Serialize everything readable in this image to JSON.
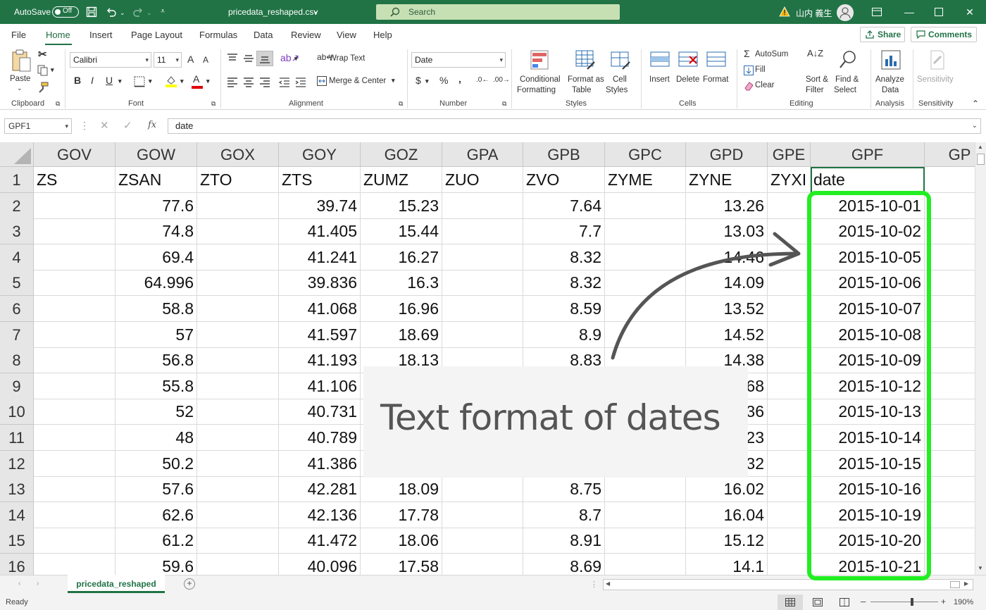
{
  "titlebar": {
    "autosave_label": "AutoSave",
    "autosave_state": "Off",
    "filename": "pricedata_reshaped.csv",
    "search_placeholder": "Search",
    "user_name": "山内 義生",
    "colors": {
      "bar": "#217346",
      "search_bg": "#c6e0b4"
    }
  },
  "menu": {
    "tabs": [
      "File",
      "Home",
      "Insert",
      "Page Layout",
      "Formulas",
      "Data",
      "Review",
      "View",
      "Help"
    ],
    "active_tab": "Home",
    "share_label": "Share",
    "comments_label": "Comments"
  },
  "ribbon": {
    "clipboard": {
      "paste": "Paste",
      "label": "Clipboard"
    },
    "font": {
      "name": "Calibri",
      "size": "11",
      "label": "Font"
    },
    "alignment": {
      "wrap_text": "Wrap Text",
      "merge_center": "Merge & Center",
      "label": "Alignment"
    },
    "number": {
      "format": "Date",
      "label": "Number"
    },
    "styles": {
      "conditional_1": "Conditional",
      "conditional_2": "Formatting",
      "format_as_1": "Format as",
      "format_as_2": "Table",
      "cell_styles_1": "Cell",
      "cell_styles_2": "Styles",
      "label": "Styles"
    },
    "cells": {
      "insert": "Insert",
      "delete": "Delete",
      "format": "Format",
      "label": "Cells"
    },
    "editing": {
      "autosum": "AutoSum",
      "fill": "Fill",
      "clear": "Clear",
      "sort_1": "Sort &",
      "sort_2": "Filter",
      "find_1": "Find &",
      "find_2": "Select",
      "label": "Editing"
    },
    "analysis": {
      "analyze_1": "Analyze",
      "analyze_2": "Data",
      "label": "Analysis"
    },
    "sensitivity": {
      "button": "Sensitivity",
      "label": "Sensitivity"
    }
  },
  "formula_bar": {
    "name_box": "GPF1",
    "fx": "fx",
    "content": "date"
  },
  "sheet": {
    "columns": [
      "GOV",
      "GOW",
      "GOX",
      "GOY",
      "GOZ",
      "GPA",
      "GPB",
      "GPC",
      "GPD",
      "GPE",
      "GPF",
      "GP"
    ],
    "row_numbers": [
      "1",
      "2",
      "3",
      "4",
      "5",
      "6",
      "7",
      "8",
      "9",
      "10",
      "11",
      "12",
      "13",
      "14",
      "15",
      "16"
    ],
    "rows": [
      [
        "ZS",
        "ZSAN",
        "ZTO",
        "ZTS",
        "ZUMZ",
        "ZUO",
        "ZVO",
        "ZYME",
        "ZYNE",
        "ZYXI",
        "date"
      ],
      [
        "",
        "77.6",
        "",
        "39.74",
        "15.23",
        "",
        "7.64",
        "",
        "13.26",
        "",
        "2015-10-01"
      ],
      [
        "",
        "74.8",
        "",
        "41.405",
        "15.44",
        "",
        "7.7",
        "",
        "13.03",
        "",
        "2015-10-02"
      ],
      [
        "",
        "69.4",
        "",
        "41.241",
        "16.27",
        "",
        "8.32",
        "",
        "14.46",
        "",
        "2015-10-05"
      ],
      [
        "",
        "64.996",
        "",
        "39.836",
        "16.3",
        "",
        "8.32",
        "",
        "14.09",
        "",
        "2015-10-06"
      ],
      [
        "",
        "58.8",
        "",
        "41.068",
        "16.96",
        "",
        "8.59",
        "",
        "13.52",
        "",
        "2015-10-07"
      ],
      [
        "",
        "57",
        "",
        "41.597",
        "18.69",
        "",
        "8.9",
        "",
        "14.52",
        "",
        "2015-10-08"
      ],
      [
        "",
        "56.8",
        "",
        "41.193",
        "18.13",
        "",
        "8.83",
        "",
        "14.38",
        "",
        "2015-10-09"
      ],
      [
        "",
        "55.8",
        "",
        "41.106",
        "",
        "",
        "",
        "",
        "68",
        "",
        "2015-10-12"
      ],
      [
        "",
        "52",
        "",
        "40.731",
        "",
        "",
        "",
        "",
        "36",
        "",
        "2015-10-13"
      ],
      [
        "",
        "48",
        "",
        "40.789",
        "",
        "",
        "",
        "",
        "23",
        "",
        "2015-10-14"
      ],
      [
        "",
        "50.2",
        "",
        "41.386",
        "",
        "",
        "",
        "",
        "32",
        "",
        "2015-10-15"
      ],
      [
        "",
        "57.6",
        "",
        "42.281",
        "18.09",
        "",
        "8.75",
        "",
        "16.02",
        "",
        "2015-10-16"
      ],
      [
        "",
        "62.6",
        "",
        "42.136",
        "17.78",
        "",
        "8.7",
        "",
        "16.04",
        "",
        "2015-10-19"
      ],
      [
        "",
        "61.2",
        "",
        "41.472",
        "18.06",
        "",
        "8.91",
        "",
        "15.12",
        "",
        "2015-10-20"
      ],
      [
        "",
        "59.6",
        "",
        "40.096",
        "17.58",
        "",
        "8.69",
        "",
        "14.1",
        "",
        "2015-10-21"
      ]
    ]
  },
  "sheet_tab": "pricedata_reshaped",
  "status": {
    "ready": "Ready",
    "zoom": "190%"
  },
  "annotation": {
    "callout": "Text format of dates",
    "highlight_color": "#22ee22"
  }
}
